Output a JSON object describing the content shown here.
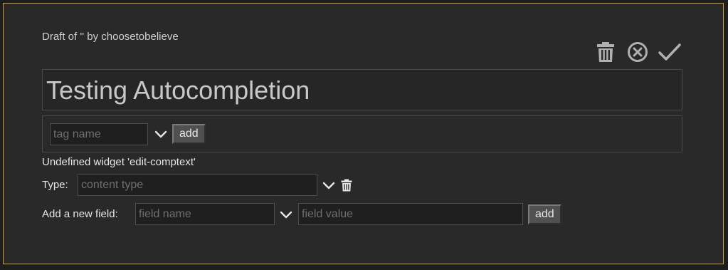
{
  "draft": {
    "subtitle": "Draft of '' by choosetobelieve",
    "title": "Testing Autocompletion"
  },
  "toolbar": {
    "delete_icon": "trash-icon",
    "cancel_icon": "close-circle-icon",
    "confirm_icon": "checkmark-icon"
  },
  "tags": {
    "input_placeholder": "tag name",
    "add_label": "add"
  },
  "widget_warning": "Undefined widget 'edit-comptext'",
  "type_row": {
    "label": "Type:",
    "placeholder": "content type"
  },
  "new_field": {
    "label": "Add a new field:",
    "name_placeholder": "field name",
    "value_placeholder": "field value",
    "add_label": "add"
  },
  "colors": {
    "background": "#292929",
    "frame_border": "#b7a36a",
    "icon": "#b0b0b0"
  }
}
